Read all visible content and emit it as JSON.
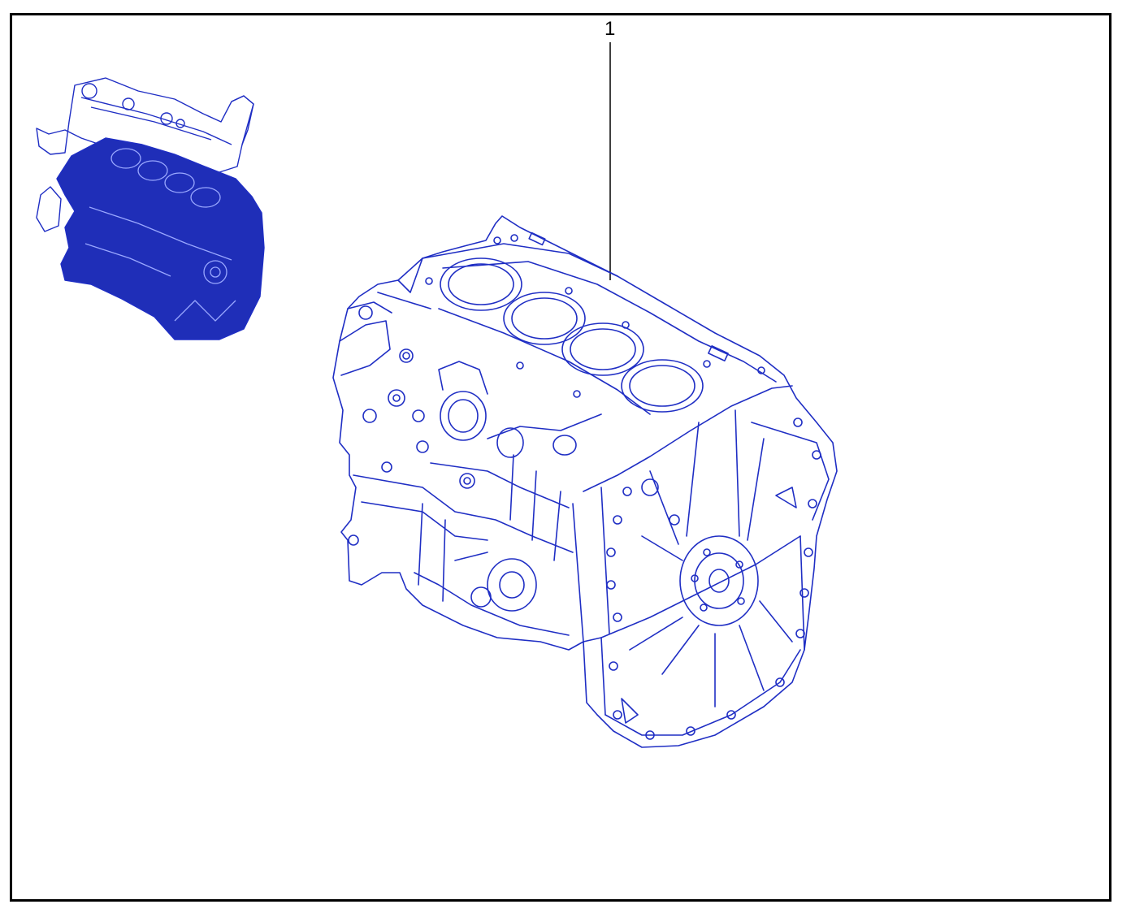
{
  "diagram": {
    "callouts": [
      {
        "number": "1"
      }
    ],
    "colors": {
      "line": "#1F2EC4",
      "fill": "#1F2EB8",
      "frame": "#000000"
    }
  }
}
